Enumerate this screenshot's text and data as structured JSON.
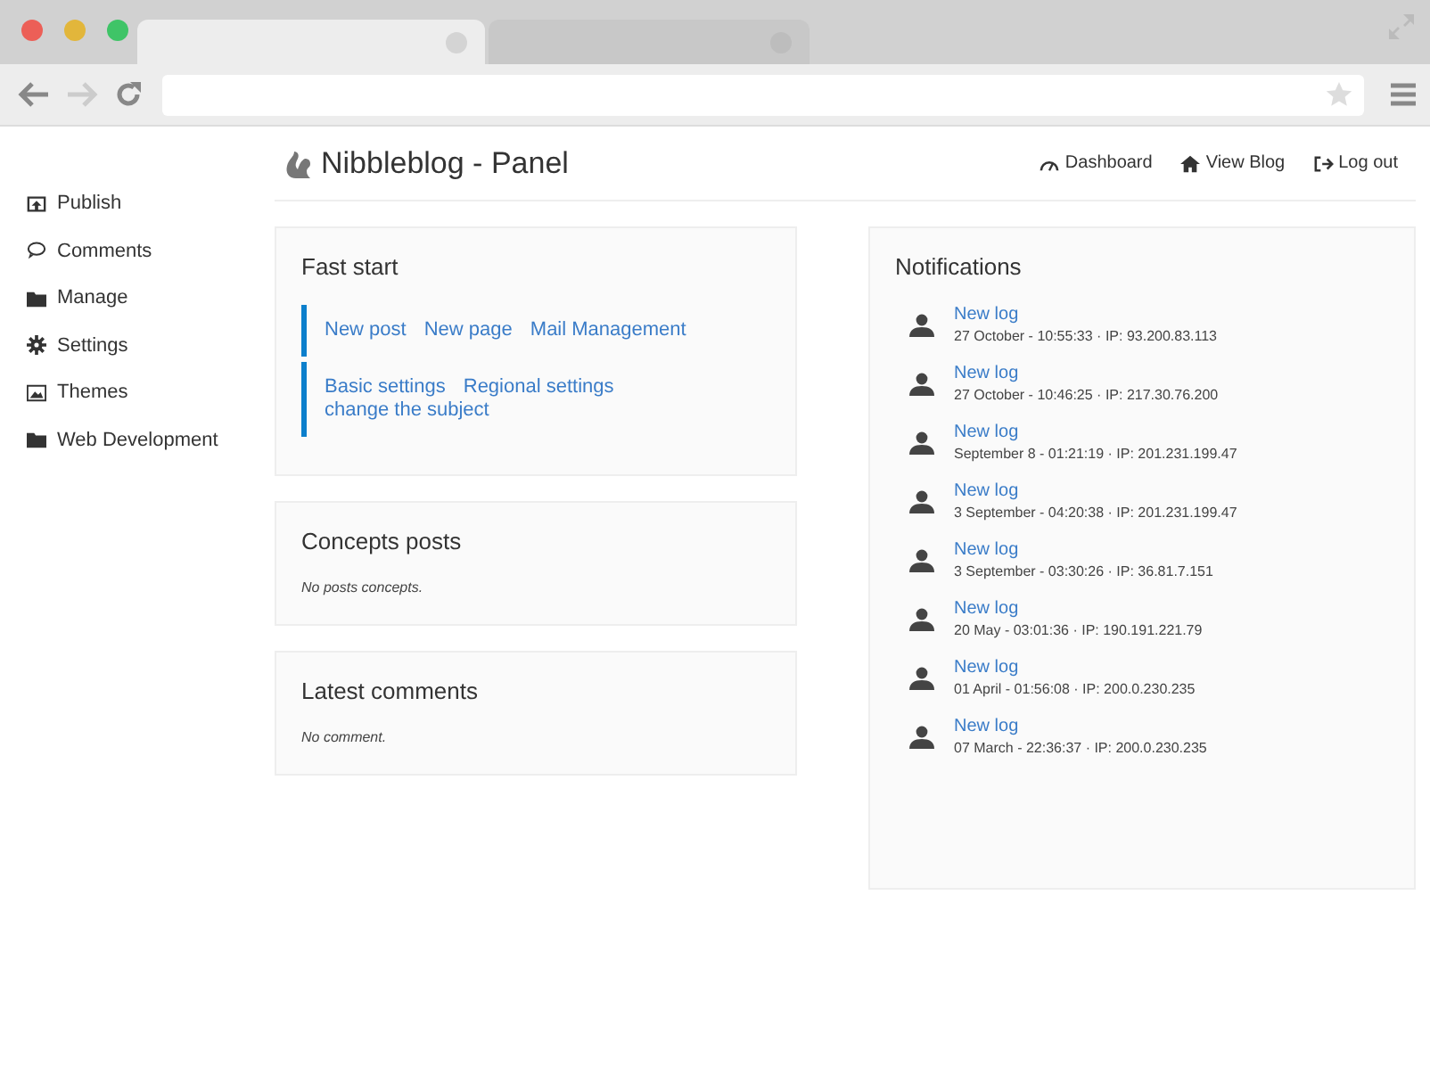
{
  "browser": {
    "tabs": [
      {
        "selected": true
      },
      {
        "selected": false
      }
    ]
  },
  "sidebar": {
    "items": [
      {
        "label": "Publish"
      },
      {
        "label": "Comments"
      },
      {
        "label": "Manage"
      },
      {
        "label": "Settings"
      },
      {
        "label": "Themes"
      },
      {
        "label": "Web Development"
      }
    ]
  },
  "header": {
    "title": "Nibbleblog - Panel",
    "nav": [
      {
        "label": "Dashboard"
      },
      {
        "label": "View Blog"
      },
      {
        "label": "Log out"
      }
    ]
  },
  "fast_start": {
    "title": "Fast start",
    "groups": [
      [
        "New post",
        "New page",
        "Mail Management"
      ],
      [
        "Basic settings",
        "Regional settings",
        "change the subject"
      ]
    ]
  },
  "concepts_posts": {
    "title": "Concepts posts",
    "empty": "No posts concepts."
  },
  "latest_comments": {
    "title": "Latest comments",
    "empty": "No comment."
  },
  "notifications": {
    "title": "Notifications",
    "items": [
      {
        "title": "New log",
        "detail": "27 October - 10:55:33 · IP: 93.200.83.113"
      },
      {
        "title": "New log",
        "detail": "27 October - 10:46:25 · IP: 217.30.76.200"
      },
      {
        "title": "New log",
        "detail": "September 8 - 01:21:19 · IP: 201.231.199.47"
      },
      {
        "title": "New log",
        "detail": "3 September - 04:20:38 · IP: 201.231.199.47"
      },
      {
        "title": "New log",
        "detail": "3 September - 03:30:26 · IP: 36.81.7.151"
      },
      {
        "title": "New log",
        "detail": "20 May - 03:01:36 · IP: 190.191.221.79"
      },
      {
        "title": "New log",
        "detail": "01 April - 01:56:08 · IP: 200.0.230.235"
      },
      {
        "title": "New log",
        "detail": "07 March - 22:36:37 · IP: 200.0.230.235"
      }
    ]
  }
}
